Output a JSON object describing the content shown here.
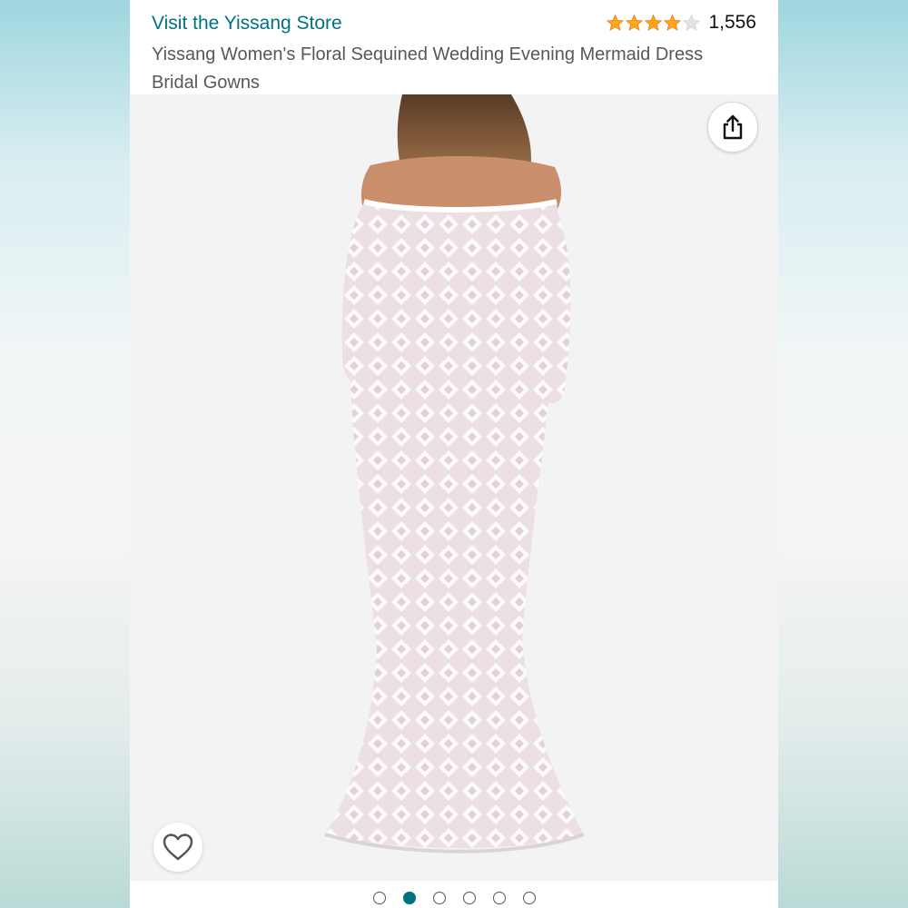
{
  "header": {
    "store_link": "Visit the Yissang Store",
    "rating_stars": 4,
    "rating_count": "1,556",
    "product_title": "Yissang Women's Floral Sequined Wedding Evening Mermaid Dress Bridal Gowns"
  },
  "gallery": {
    "share_icon": "share-icon",
    "favorite_icon": "heart-icon",
    "total_images": 6,
    "active_index": 1
  },
  "colors": {
    "link": "#007185",
    "star": "#ffa41c",
    "title": "#565959"
  }
}
